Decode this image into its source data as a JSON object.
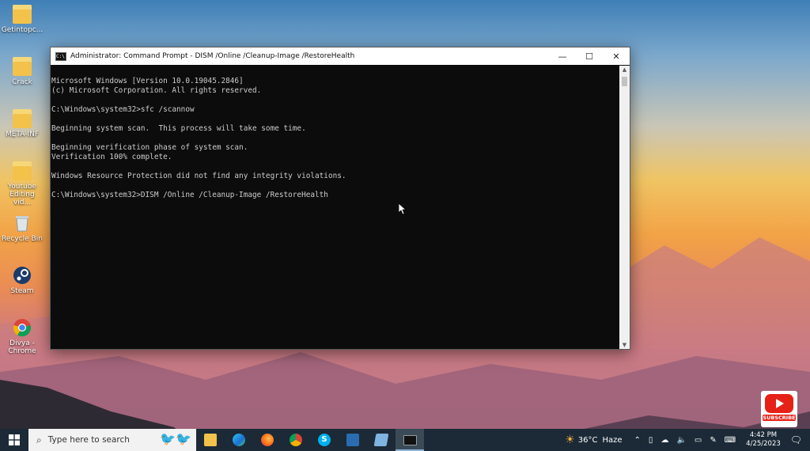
{
  "desktop": {
    "icons": [
      {
        "label": "Getintopc..."
      },
      {
        "label": "Crack"
      },
      {
        "label": "META-INF"
      },
      {
        "label": "Youtube Editing vid..."
      },
      {
        "label": "Recycle Bin"
      },
      {
        "label": "Steam"
      },
      {
        "label": "Divya - Chrome"
      }
    ]
  },
  "window": {
    "title": "Administrator: Command Prompt - DISM  /Online /Cleanup-Image /RestoreHealth",
    "minimize_glyph": "—",
    "maximize_glyph": "☐",
    "close_glyph": "✕",
    "console_lines": [
      "Microsoft Windows [Version 10.0.19045.2846]",
      "(c) Microsoft Corporation. All rights reserved.",
      "",
      "C:\\Windows\\system32>sfc /scannow",
      "",
      "Beginning system scan.  This process will take some time.",
      "",
      "Beginning verification phase of system scan.",
      "Verification 100% complete.",
      "",
      "Windows Resource Protection did not find any integrity violations.",
      "",
      "C:\\Windows\\system32>DISM /Online /Cleanup-Image /RestoreHealth"
    ]
  },
  "subscribe": {
    "label": "SUBSCRIBE"
  },
  "taskbar": {
    "search_placeholder": "Type here to search",
    "apps": [
      "file-explorer",
      "edge",
      "firefox",
      "chrome",
      "skype",
      "download-tool",
      "notes",
      "command-prompt"
    ],
    "weather": {
      "temp": "36°C",
      "condition": "Haze"
    },
    "clock": {
      "time": "4:42 PM",
      "date": "4/25/2023"
    }
  }
}
